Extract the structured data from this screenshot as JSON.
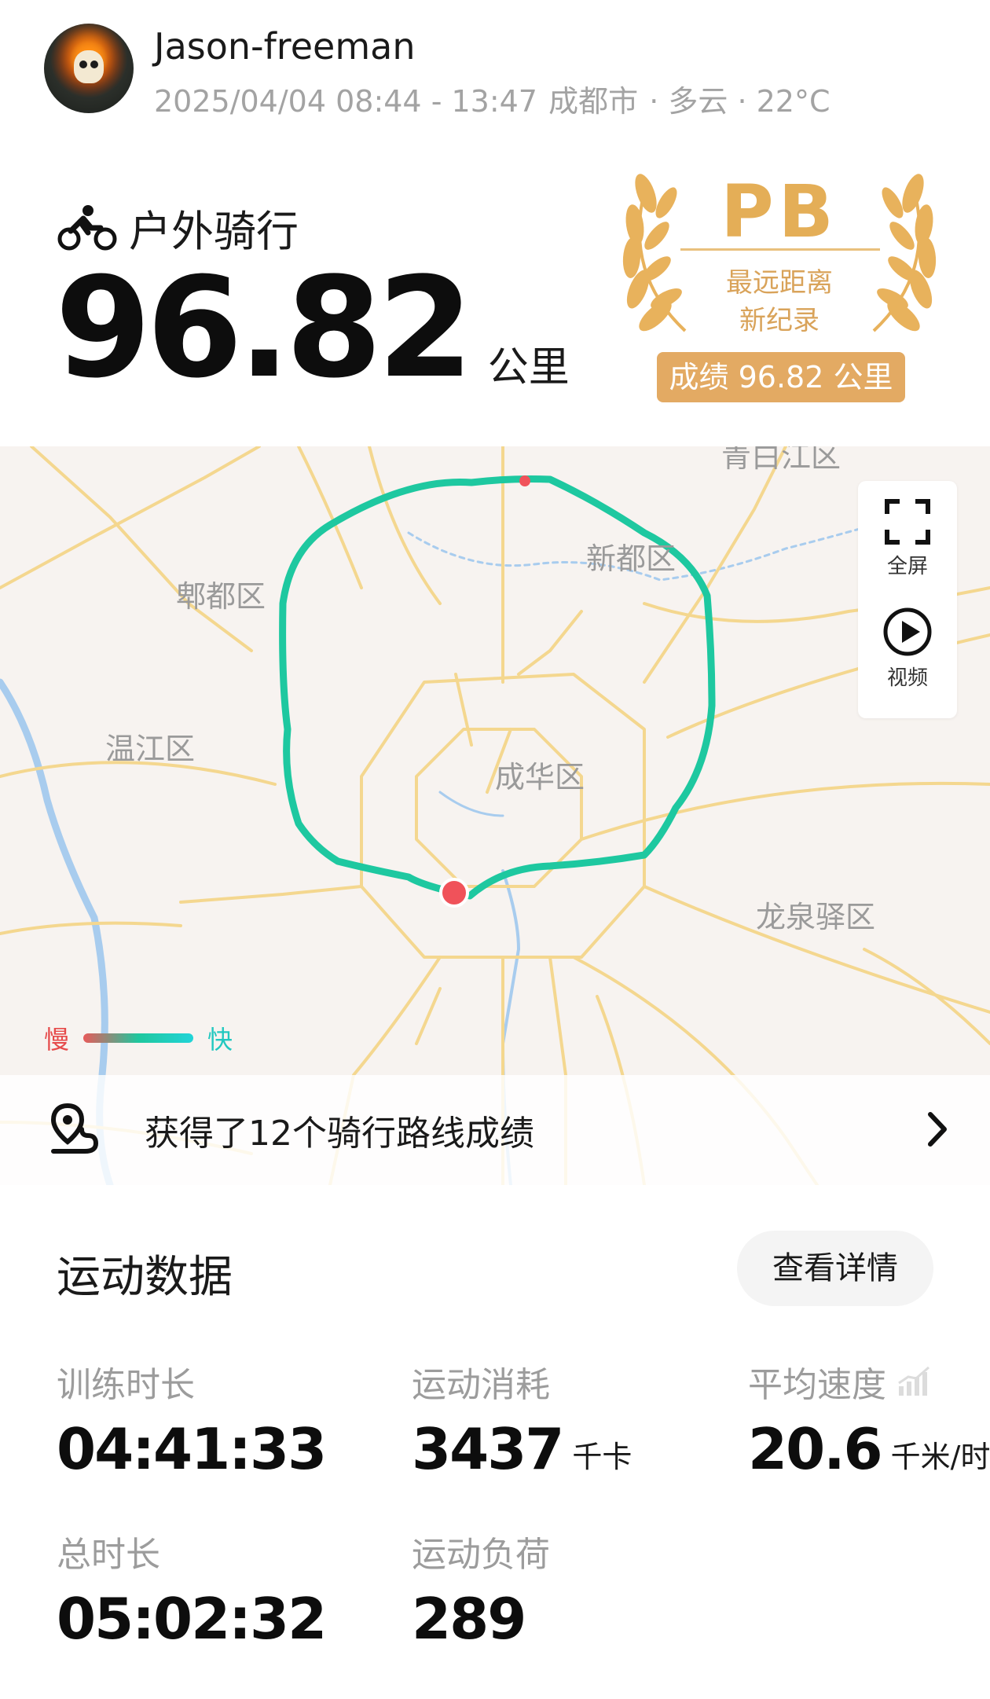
{
  "header": {
    "user_name": "Jason-freeman",
    "date_time": "2025/04/04 08:44 - 13:47",
    "location": "成都市",
    "weather": "· 多云 · 22°C"
  },
  "summary": {
    "sport_type": "户外骑行",
    "sport_icon": "cycling-icon",
    "distance": "96.82",
    "distance_unit": "公里"
  },
  "pb_badge": {
    "title": "PB",
    "subtitle_line1": "最远距离",
    "subtitle_line2": "新纪录",
    "result": "成绩 96.82 公里",
    "color": "#e4ae57"
  },
  "map": {
    "districts": {
      "top": "青白江区",
      "xindu": "新都区",
      "pidu": "郫都区",
      "wenjiang": "温江区",
      "chenghua": "成华区",
      "longquanyi": "龙泉驿区"
    },
    "tools": {
      "fullscreen_label": "全屏",
      "video_label": "视频"
    },
    "legend": {
      "slow": "慢",
      "fast": "快"
    },
    "route_color": "#1ec8a0",
    "start_marker_color": "#f0525a"
  },
  "route_achievements": {
    "text": "获得了12个骑行路线成绩"
  },
  "stats": {
    "title": "运动数据",
    "detail_button": "查看详情",
    "items": [
      {
        "label": "训练时长",
        "value": "04:41:33",
        "unit": ""
      },
      {
        "label": "运动消耗",
        "value": "3437",
        "unit": "千卡"
      },
      {
        "label": "平均速度",
        "value": "20.6",
        "unit": "千米/时"
      },
      {
        "label": "总时长",
        "value": "05:02:32",
        "unit": ""
      },
      {
        "label": "运动负荷",
        "value": "289",
        "unit": ""
      }
    ]
  }
}
